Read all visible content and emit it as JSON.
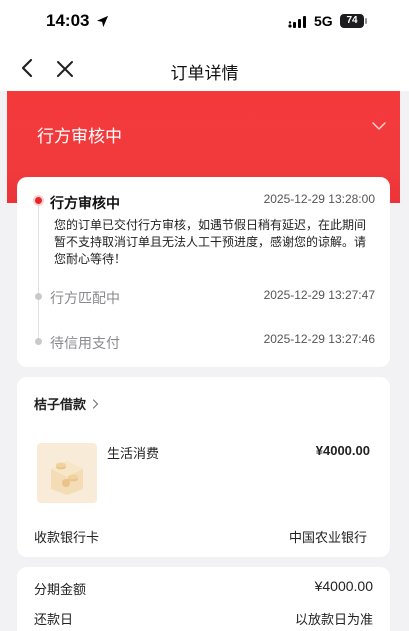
{
  "status_bar": {
    "time": "14:03",
    "network": "5G",
    "battery": "74"
  },
  "nav": {
    "title": "订单详情"
  },
  "banner": {
    "status": "行方审核中",
    "accent": "#f13a3c"
  },
  "timeline": {
    "items": [
      {
        "title": "行方审核中",
        "time": "2025-12-29 13:28:00",
        "description": "您的订单已交付行方审核，如遇节假日稍有延迟，在此期间暂不支持取消订单且无法人工干预进度，感谢您的谅解。请您耐心等待！"
      },
      {
        "title": "行方匹配中",
        "time": "2025-12-29 13:27:47"
      },
      {
        "title": "待信用支付",
        "time": "2025-12-29 13:27:46"
      }
    ]
  },
  "product": {
    "merchant": "桔子借款",
    "item_name": "生活消费",
    "price": "¥4000.00",
    "bank_label": "收款银行卡",
    "bank_value": "中国农业银行"
  },
  "installment": {
    "amount_label": "分期金额",
    "amount_value": "¥4000.00",
    "repay_label": "还款日",
    "repay_value": "以放款日为准"
  }
}
